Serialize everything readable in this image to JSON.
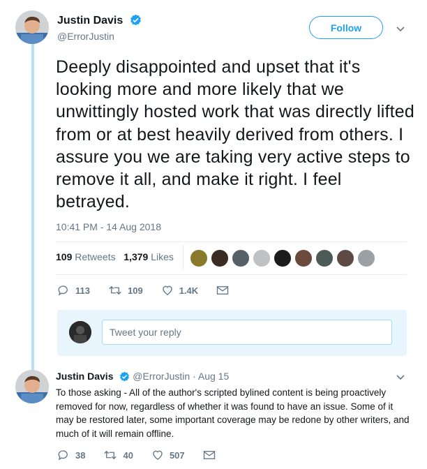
{
  "tweet": {
    "author_name": "Justin Davis",
    "author_handle": "@ErrorJustin",
    "follow_label": "Follow",
    "text": "Deeply disappointed and upset that it's looking more and more likely that we unwittingly hosted work that was directly lifted from or at best heavily derived from others. I assure you we are taking very active steps to remove it all, and make it right. I feel betrayed.",
    "timestamp": "10:41 PM - 14 Aug 2018",
    "retweets_count": "109",
    "retweets_label": "Retweets",
    "likes_count": "1,379",
    "likes_label": "Likes",
    "actions": {
      "replies": "113",
      "retweets": "109",
      "likes": "1.4K"
    }
  },
  "reply_box": {
    "placeholder": "Tweet your reply"
  },
  "reply_tweet": {
    "author_name": "Justin Davis",
    "author_handle": "@ErrorJustin",
    "separator": "·",
    "date": "Aug 15",
    "text": "To those asking - All of the author's scripted bylined content is being proactively removed for now, regardless of whether it was found to have an issue. Some of it may be restored later, some important coverage may be redone by other writers, and much of it will remain offline.",
    "actions": {
      "replies": "38",
      "retweets": "40",
      "likes": "507"
    }
  },
  "icons": [
    "verified-badge-icon",
    "chevron-down-icon",
    "reply-icon",
    "retweet-icon",
    "like-icon",
    "direct-message-icon"
  ],
  "colors": {
    "accent": "#1da1f2",
    "thread_line": "#b9ddf4",
    "reply_box_bg": "#e8f5fd",
    "muted_text": "#657786"
  }
}
